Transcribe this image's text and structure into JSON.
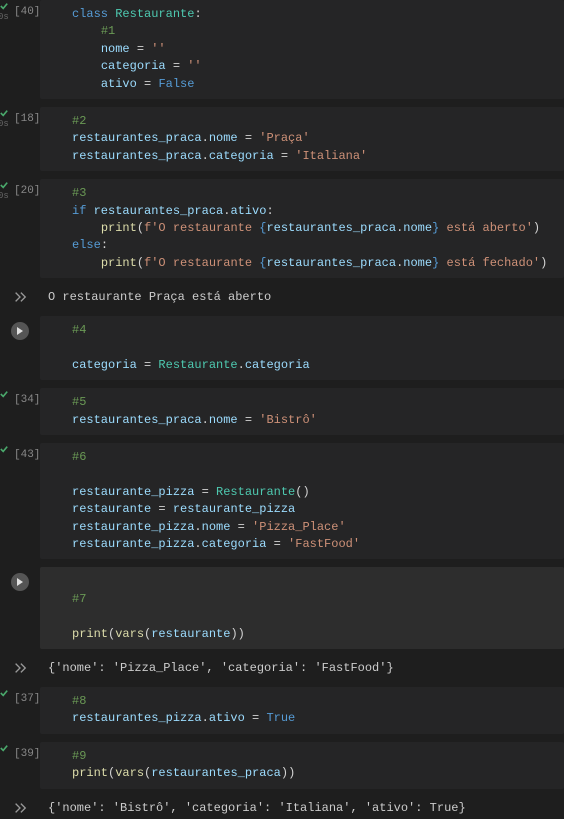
{
  "cells": [
    {
      "count": "[40]",
      "mark": "check",
      "time": "0s",
      "lines": [
        [
          {
            "c": "kw",
            "t": "class "
          },
          {
            "c": "cls",
            "t": "Restaurante"
          },
          {
            "c": "p",
            "t": ":"
          }
        ],
        [
          {
            "c": "p",
            "t": "    "
          },
          {
            "c": "comment",
            "t": "#1"
          }
        ],
        [
          {
            "c": "p",
            "t": "    "
          },
          {
            "c": "attr",
            "t": "nome"
          },
          {
            "c": "p",
            "t": " = "
          },
          {
            "c": "str",
            "t": "''"
          }
        ],
        [
          {
            "c": "p",
            "t": "    "
          },
          {
            "c": "attr",
            "t": "categoria"
          },
          {
            "c": "p",
            "t": " = "
          },
          {
            "c": "str",
            "t": "''"
          }
        ],
        [
          {
            "c": "p",
            "t": "    "
          },
          {
            "c": "attr",
            "t": "ativo"
          },
          {
            "c": "p",
            "t": " = "
          },
          {
            "c": "const",
            "t": "False"
          }
        ]
      ]
    },
    {
      "count": "[18]",
      "mark": "check",
      "time": "0s",
      "lines": [
        [
          {
            "c": "comment",
            "t": "#2"
          }
        ],
        [
          {
            "c": "attr",
            "t": "restaurantes_praca"
          },
          {
            "c": "p",
            "t": "."
          },
          {
            "c": "attr",
            "t": "nome"
          },
          {
            "c": "p",
            "t": " = "
          },
          {
            "c": "str",
            "t": "'Praça'"
          }
        ],
        [
          {
            "c": "attr",
            "t": "restaurantes_praca"
          },
          {
            "c": "p",
            "t": "."
          },
          {
            "c": "attr",
            "t": "categoria"
          },
          {
            "c": "p",
            "t": " = "
          },
          {
            "c": "str",
            "t": "'Italiana'"
          }
        ]
      ]
    },
    {
      "count": "[20]",
      "mark": "check",
      "time": "0s",
      "lines": [
        [
          {
            "c": "comment",
            "t": "#3"
          }
        ],
        [
          {
            "c": "kw",
            "t": "if "
          },
          {
            "c": "attr",
            "t": "restaurantes_praca"
          },
          {
            "c": "p",
            "t": "."
          },
          {
            "c": "attr",
            "t": "ativo"
          },
          {
            "c": "p",
            "t": ":"
          }
        ],
        [
          {
            "c": "p",
            "t": "    "
          },
          {
            "c": "fn",
            "t": "print"
          },
          {
            "c": "p",
            "t": "("
          },
          {
            "c": "str",
            "t": "f'O restaurante "
          },
          {
            "c": "fstr-br",
            "t": "{"
          },
          {
            "c": "attr",
            "t": "restaurantes_praca"
          },
          {
            "c": "p",
            "t": "."
          },
          {
            "c": "attr",
            "t": "nome"
          },
          {
            "c": "fstr-br",
            "t": "}"
          },
          {
            "c": "str",
            "t": " está aberto'"
          },
          {
            "c": "p",
            "t": ")"
          }
        ],
        [
          {
            "c": "kw",
            "t": "else"
          },
          {
            "c": "p",
            "t": ":"
          }
        ],
        [
          {
            "c": "p",
            "t": "    "
          },
          {
            "c": "fn",
            "t": "print"
          },
          {
            "c": "p",
            "t": "("
          },
          {
            "c": "str",
            "t": "f'O restaurante "
          },
          {
            "c": "fstr-br",
            "t": "{"
          },
          {
            "c": "attr",
            "t": "restaurantes_praca"
          },
          {
            "c": "p",
            "t": "."
          },
          {
            "c": "attr",
            "t": "nome"
          },
          {
            "c": "fstr-br",
            "t": "}"
          },
          {
            "c": "str",
            "t": " está fechado'"
          },
          {
            "c": "p",
            "t": ")"
          }
        ]
      ],
      "output": "O restaurante Praça está aberto"
    },
    {
      "count": "",
      "mark": "play",
      "lines": [
        [
          {
            "c": "comment",
            "t": "#4"
          }
        ],
        [
          {
            "c": "p",
            "t": ""
          }
        ],
        [
          {
            "c": "attr",
            "t": "categoria"
          },
          {
            "c": "p",
            "t": " = "
          },
          {
            "c": "cls",
            "t": "Restaurante"
          },
          {
            "c": "p",
            "t": "."
          },
          {
            "c": "attr",
            "t": "categoria"
          }
        ]
      ]
    },
    {
      "count": "[34]",
      "mark": "check",
      "lines": [
        [
          {
            "c": "comment",
            "t": "#5"
          }
        ],
        [
          {
            "c": "attr",
            "t": "restaurantes_praca"
          },
          {
            "c": "p",
            "t": "."
          },
          {
            "c": "attr",
            "t": "nome"
          },
          {
            "c": "p",
            "t": " = "
          },
          {
            "c": "str",
            "t": "'Bistrô'"
          }
        ]
      ]
    },
    {
      "count": "[43]",
      "mark": "check",
      "lines": [
        [
          {
            "c": "comment",
            "t": "#6"
          }
        ],
        [
          {
            "c": "p",
            "t": ""
          }
        ],
        [
          {
            "c": "attr",
            "t": "restaurante_pizza"
          },
          {
            "c": "p",
            "t": " = "
          },
          {
            "c": "cls",
            "t": "Restaurante"
          },
          {
            "c": "p",
            "t": "()"
          }
        ],
        [
          {
            "c": "attr",
            "t": "restaurante"
          },
          {
            "c": "p",
            "t": " = "
          },
          {
            "c": "attr",
            "t": "restaurante_pizza"
          }
        ],
        [
          {
            "c": "attr",
            "t": "restaurante_pizza"
          },
          {
            "c": "p",
            "t": "."
          },
          {
            "c": "attr",
            "t": "nome"
          },
          {
            "c": "p",
            "t": " = "
          },
          {
            "c": "str",
            "t": "'Pizza_Place'"
          }
        ],
        [
          {
            "c": "attr",
            "t": "restaurante_pizza"
          },
          {
            "c": "p",
            "t": "."
          },
          {
            "c": "attr",
            "t": "categoria"
          },
          {
            "c": "p",
            "t": " = "
          },
          {
            "c": "str",
            "t": "'FastFood'"
          }
        ]
      ]
    },
    {
      "count": "",
      "mark": "play",
      "active": true,
      "lines": [
        [
          {
            "c": "p",
            "t": ""
          }
        ],
        [
          {
            "c": "comment",
            "t": "#7"
          }
        ],
        [
          {
            "c": "p",
            "t": ""
          }
        ],
        [
          {
            "c": "fn",
            "t": "print"
          },
          {
            "c": "p",
            "t": "("
          },
          {
            "c": "fn",
            "t": "vars"
          },
          {
            "c": "p",
            "t": "("
          },
          {
            "c": "attr",
            "t": "restaurante"
          },
          {
            "c": "p",
            "t": ")"
          },
          {
            "c": "p",
            "t": ")"
          }
        ]
      ],
      "output": "{'nome': 'Pizza_Place', 'categoria': 'FastFood'}"
    },
    {
      "count": "[37]",
      "mark": "check",
      "lines": [
        [
          {
            "c": "comment",
            "t": "#8"
          }
        ],
        [
          {
            "c": "attr",
            "t": "restaurantes_pizza"
          },
          {
            "c": "p",
            "t": "."
          },
          {
            "c": "attr",
            "t": "ativo"
          },
          {
            "c": "p",
            "t": " = "
          },
          {
            "c": "const",
            "t": "True"
          }
        ]
      ]
    },
    {
      "count": "[39]",
      "mark": "check",
      "lines": [
        [
          {
            "c": "comment",
            "t": "#9"
          }
        ],
        [
          {
            "c": "fn",
            "t": "print"
          },
          {
            "c": "p",
            "t": "("
          },
          {
            "c": "fn",
            "t": "vars"
          },
          {
            "c": "p",
            "t": "("
          },
          {
            "c": "attr",
            "t": "restaurantes_praca"
          },
          {
            "c": "p",
            "t": ")"
          },
          {
            "c": "p",
            "t": ")"
          }
        ]
      ],
      "output": "{'nome': 'Bistrô', 'categoria': 'Italiana', 'ativo': True}"
    }
  ]
}
